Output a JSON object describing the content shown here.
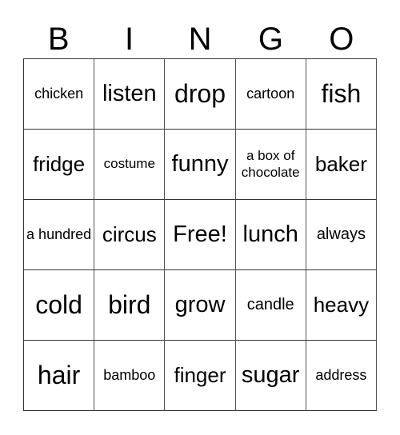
{
  "header": [
    "B",
    "I",
    "N",
    "G",
    "O"
  ],
  "cells": [
    {
      "text": "chicken",
      "size": "s-xs"
    },
    {
      "text": "listen",
      "size": "s-l"
    },
    {
      "text": "drop",
      "size": "s-xl"
    },
    {
      "text": "cartoon",
      "size": "s-xs"
    },
    {
      "text": "fish",
      "size": "s-xl"
    },
    {
      "text": "fridge",
      "size": "s-m"
    },
    {
      "text": "costume",
      "size": "s-xxs"
    },
    {
      "text": "funny",
      "size": "s-l"
    },
    {
      "text": "a box of chocolate",
      "size": "s-xxs"
    },
    {
      "text": "baker",
      "size": "s-m"
    },
    {
      "text": "a hundred",
      "size": "s-xs"
    },
    {
      "text": "circus",
      "size": "s-m"
    },
    {
      "text": "Free!",
      "size": "s-l"
    },
    {
      "text": "lunch",
      "size": "s-l"
    },
    {
      "text": "always",
      "size": "s-s"
    },
    {
      "text": "cold",
      "size": "s-xl"
    },
    {
      "text": "bird",
      "size": "s-xl"
    },
    {
      "text": "grow",
      "size": "s-l"
    },
    {
      "text": "candle",
      "size": "s-s"
    },
    {
      "text": "heavy",
      "size": "s-m"
    },
    {
      "text": "hair",
      "size": "s-xl"
    },
    {
      "text": "bamboo",
      "size": "s-xs"
    },
    {
      "text": "finger",
      "size": "s-m"
    },
    {
      "text": "sugar",
      "size": "s-l"
    },
    {
      "text": "address",
      "size": "s-xs"
    }
  ]
}
